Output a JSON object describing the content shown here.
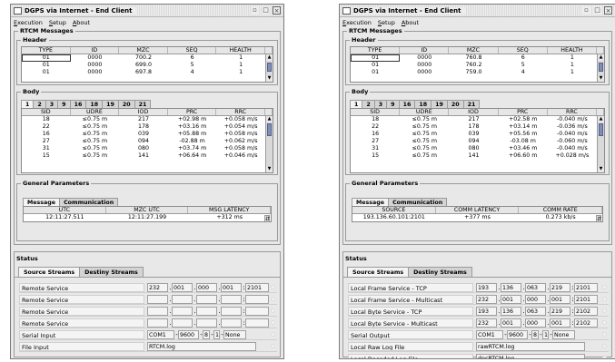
{
  "windows": [
    {
      "title": "DGPS via Internet - End Client",
      "menu": [
        "Execution",
        "Setup",
        "About"
      ],
      "rtcm_title": "RTCM Messages",
      "header_group": "Header",
      "header_cols": [
        "TYPE",
        "ID",
        "MZC",
        "SEQ",
        "HEALTH"
      ],
      "header_rows": [
        [
          "01",
          "0000",
          "700.2",
          "6",
          "1"
        ],
        [
          "01",
          "0000",
          "699.0",
          "5",
          "1"
        ],
        [
          "01",
          "0000",
          "697.8",
          "4",
          "1"
        ]
      ],
      "body_group": "Body",
      "body_tabs": [
        "1",
        "2",
        "3",
        "9",
        "16",
        "18",
        "19",
        "20",
        "21"
      ],
      "body_cols": [
        "SID",
        "UDRE",
        "IOD",
        "PRC",
        "RRC"
      ],
      "body_rows": [
        [
          "18",
          "≤0.75 m",
          "217",
          "+02.98 m",
          "+0.058 m/s"
        ],
        [
          "22",
          "≤0.75 m",
          "178",
          "+03.16 m",
          "+0.054 m/s"
        ],
        [
          "16",
          "≤0.75 m",
          "039",
          "+05.88 m",
          "+0.058 m/s"
        ],
        [
          "27",
          "≤0.75 m",
          "094",
          "-02.88 m",
          "+0.062 m/s"
        ],
        [
          "31",
          "≤0.75 m",
          "080",
          "+03.74 m",
          "+0.058 m/s"
        ],
        [
          "15",
          "≤0.75 m",
          "141",
          "+06.64 m",
          "+0.046 m/s"
        ]
      ],
      "gp_group": "General Parameters",
      "gp_tabs": [
        "Message",
        "Communication"
      ],
      "gp_cols": [
        "UTC",
        "MZC UTC",
        "MSG LATENCY"
      ],
      "gp_row": [
        "12:11:27.511",
        "12:11:27.199",
        "+312 ms"
      ],
      "status_title": "Status",
      "status_tabs": [
        "Source Streams",
        "Destiny Streams"
      ],
      "stream_rows": [
        {
          "label": "Remote Service",
          "f": [
            "232",
            "001",
            "000",
            "001",
            "2101"
          ]
        },
        {
          "label": "Remote Service",
          "f": [
            "",
            "",
            "",
            "",
            ""
          ]
        },
        {
          "label": "Remote Service",
          "f": [
            "",
            "",
            "",
            "",
            ""
          ]
        },
        {
          "label": "Remote Service",
          "f": [
            "",
            "",
            "",
            "",
            ""
          ]
        },
        {
          "label": "Serial Input",
          "f": [
            "COM1",
            "9600",
            "8",
            "1",
            "None"
          ]
        },
        {
          "label": "File Input",
          "f": [
            "RTCM.log"
          ]
        }
      ]
    },
    {
      "title": "DGPS via Internet - End Client",
      "menu": [
        "Execution",
        "Setup",
        "About"
      ],
      "rtcm_title": "RTCM Messages",
      "header_group": "Header",
      "header_cols": [
        "TYPE",
        "ID",
        "MZC",
        "SEQ",
        "HEALTH"
      ],
      "header_rows": [
        [
          "01",
          "0000",
          "760.8",
          "6",
          "1"
        ],
        [
          "01",
          "0000",
          "760.2",
          "5",
          "1"
        ],
        [
          "01",
          "0000",
          "759.0",
          "4",
          "1"
        ]
      ],
      "body_group": "Body",
      "body_tabs": [
        "1",
        "2",
        "3",
        "9",
        "16",
        "18",
        "19",
        "20",
        "21"
      ],
      "body_cols": [
        "SID",
        "UDRE",
        "IOD",
        "PRC",
        "RRC"
      ],
      "body_rows": [
        [
          "18",
          "≤0.75 m",
          "217",
          "+02.58 m",
          "-0.040 m/s"
        ],
        [
          "22",
          "≤0.75 m",
          "178",
          "+03.14 m",
          "-0.036 m/s"
        ],
        [
          "16",
          "≤0.75 m",
          "039",
          "+05.56 m",
          "-0.040 m/s"
        ],
        [
          "27",
          "≤0.75 m",
          "094",
          "-03.08 m",
          "-0.060 m/s"
        ],
        [
          "31",
          "≤0.75 m",
          "080",
          "+03.46 m",
          "-0.040 m/s"
        ],
        [
          "15",
          "≤0.75 m",
          "141",
          "+06.60 m",
          "+0.028 m/s"
        ]
      ],
      "gp_group": "General Parameters",
      "gp_tabs": [
        "Message",
        "Communication"
      ],
      "gp_cols": [
        "SOURCE",
        "COMM LATENCY",
        "COMM RATE"
      ],
      "gp_row": [
        "193.136.60.101:2101",
        "+377 ms",
        "0.273 kb/s"
      ],
      "status_title": "Status",
      "status_tabs": [
        "Source Streams",
        "Destiny Streams"
      ],
      "stream_rows": [
        {
          "label": "Local Frame Service - TCP",
          "f": [
            "193",
            "136",
            "063",
            "219",
            "2101"
          ]
        },
        {
          "label": "Local Frame Service - Multicast",
          "f": [
            "232",
            "001",
            "000",
            "001",
            "2101"
          ]
        },
        {
          "label": "Local Byte Service - TCP",
          "f": [
            "193",
            "136",
            "063",
            "219",
            "2102"
          ]
        },
        {
          "label": "Local Byte Service - Multicast",
          "f": [
            "232",
            "001",
            "000",
            "001",
            "2102"
          ]
        },
        {
          "label": "Serial Output",
          "f": [
            "COM1",
            "9600",
            "8",
            "1",
            "None"
          ]
        },
        {
          "label": "Local Raw Log File",
          "f": [
            "rawRTCM.log"
          ]
        },
        {
          "label": "Local Decoded Log File",
          "f": [
            "decRTCM.log"
          ]
        }
      ]
    }
  ]
}
